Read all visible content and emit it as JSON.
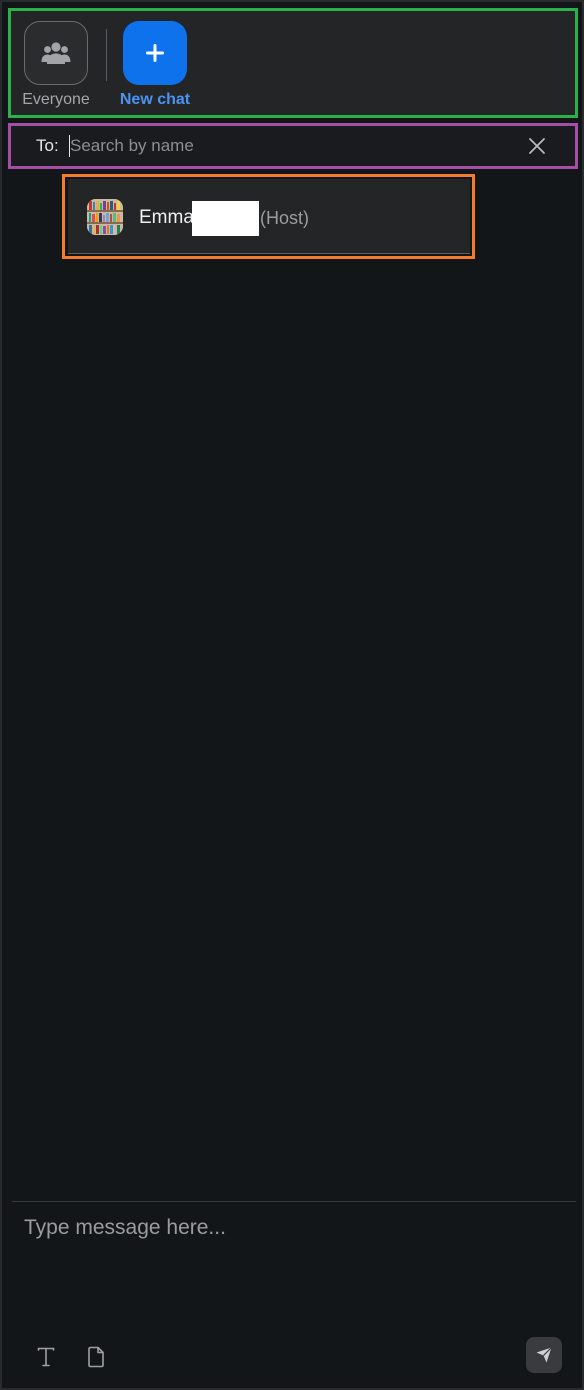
{
  "chat_types": {
    "everyone": {
      "label": "Everyone",
      "icon": "group-icon"
    },
    "new_chat": {
      "label": "New chat",
      "icon": "plus-icon",
      "active": true
    }
  },
  "recipient": {
    "to_label": "To:",
    "search_placeholder": "Search by name",
    "clear_icon": "close-icon"
  },
  "suggestions": [
    {
      "name": "Emma",
      "role": "(Host)",
      "avatar": "avatar-bookshelf-image"
    }
  ],
  "composer": {
    "placeholder": "Type message here...",
    "format_icon": "text-format-icon",
    "file_icon": "file-icon",
    "send_icon": "send-icon"
  },
  "colors": {
    "accent": "#0e72ed",
    "active_label": "#4a93f5",
    "toolbar_highlight": "#2bb04a",
    "recipient_highlight": "#a54ea5",
    "suggestion_highlight": "#f47c2c",
    "background": "#131619"
  }
}
